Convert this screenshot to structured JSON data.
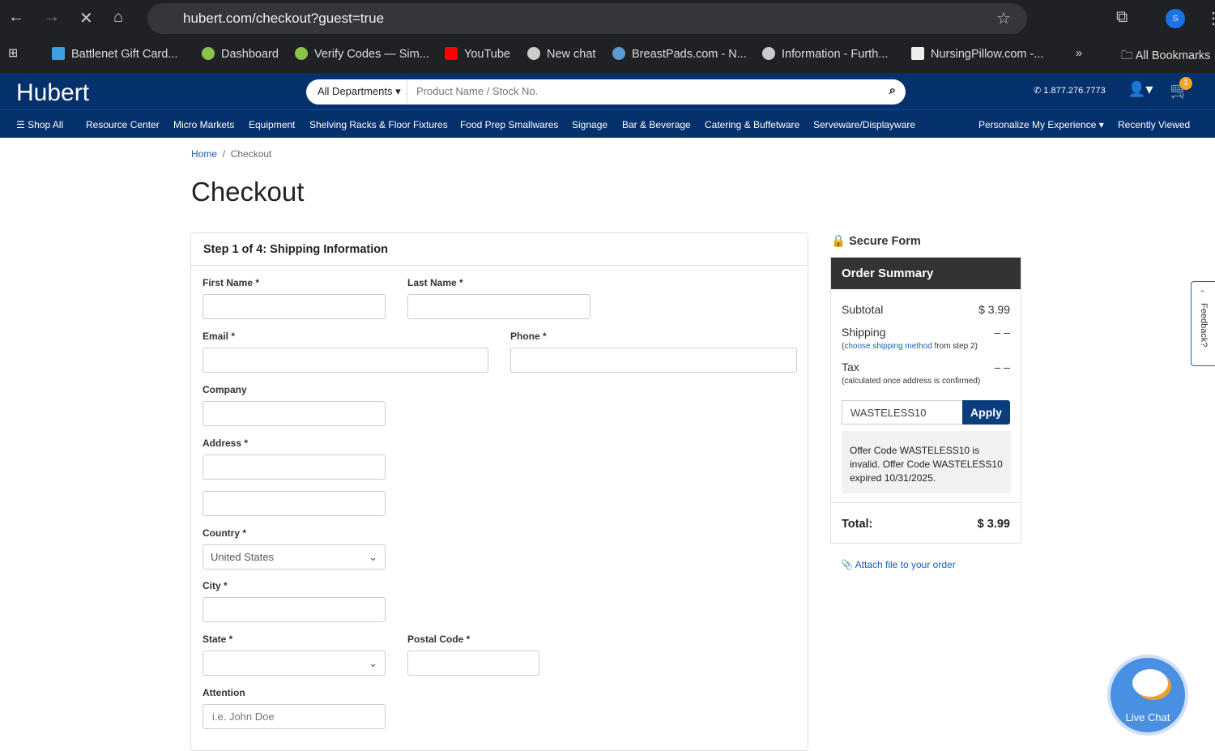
{
  "browser": {
    "url": "hubert.com/checkout?guest=true",
    "profile_initial": "S",
    "bookmarks": [
      "Battlenet Gift Card...",
      "Dashboard",
      "Verify Codes — Sim...",
      "YouTube",
      "New chat",
      "BreastPads.com - N...",
      "Information - Furth...",
      "NursingPillow.com -...",
      "All Bookmarks"
    ]
  },
  "header": {
    "logo": "Hubert",
    "dept": "All Departments ▾",
    "search_placeholder": "Product Name / Stock No.",
    "phone": "1.877.276.7773",
    "cart_count": "1"
  },
  "nav": [
    "Shop All",
    "Resource Center",
    "Micro Markets",
    "Equipment",
    "Shelving Racks & Floor Fixtures",
    "Food Prep Smallwares",
    "Signage",
    "Bar & Beverage",
    "Catering & Buffetware",
    "Serveware/Displayware",
    "Personalize My Experience ▾",
    "Recently Viewed"
  ],
  "breadcrumb": {
    "home": "Home",
    "current": "Checkout"
  },
  "page_title": "Checkout",
  "form": {
    "step": "Step 1 of 4: Shipping Information",
    "first_name": "First Name *",
    "last_name": "Last Name *",
    "email": "Email *",
    "phone": "Phone *",
    "company": "Company",
    "address": "Address *",
    "country": "Country *",
    "country_value": "United States",
    "city": "City *",
    "state": "State *",
    "postal": "Postal Code *",
    "attention": "Attention",
    "attention_placeholder": "i.e. John Doe"
  },
  "summary": {
    "secure": "Secure Form",
    "title": "Order Summary",
    "subtotal_label": "Subtotal",
    "subtotal": "$ 3.99",
    "shipping_label": "Shipping",
    "shipping": "– –",
    "shipping_note_link": "choose shipping method",
    "shipping_note_rest": " from step 2)",
    "shipping_note_open": "(",
    "tax_label": "Tax",
    "tax": "– –",
    "tax_note": "(calculated once address is confirmed)",
    "code": "WASTELESS10",
    "apply": "Apply",
    "message": "Offer Code WASTELESS10 is invalid. Offer Code WASTELESS10 expired 10/31/2025.",
    "total_label": "Total:",
    "total": "$ 3.99",
    "attach": "Attach file to your order"
  },
  "feedback": "Feedback?",
  "chat": "Live Chat"
}
